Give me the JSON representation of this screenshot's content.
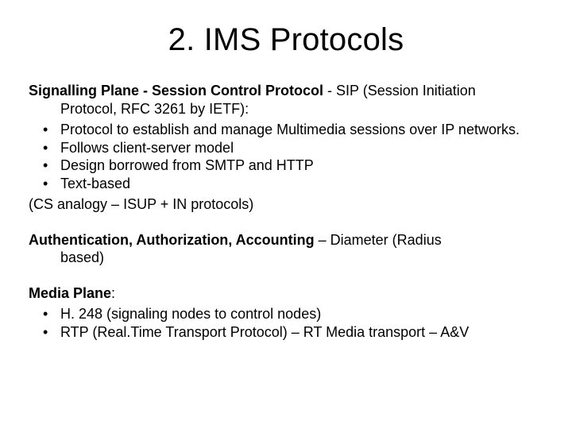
{
  "title": "2. IMS Protocols",
  "signalling": {
    "lead_bold": "Signalling Plane - Session Control Protocol",
    "lead_rest": " - SIP (Session Initiation",
    "lead_line2": "Protocol, RFC 3261 by IETF):",
    "bullets": [
      "Protocol to establish and manage Multimedia sessions over IP networks.",
      "Follows client-server model",
      "Design borrowed from SMTP and HTTP",
      "Text-based"
    ],
    "footer": "(CS analogy – ISUP + IN protocols)"
  },
  "aaa": {
    "lead_bold": "Authentication, Authorization, Accounting",
    "lead_rest": " – Diameter (Radius",
    "lead_line2": "based)"
  },
  "media": {
    "lead_bold": "Media Plane",
    "lead_rest": ":",
    "bullets": [
      "H. 248 (signaling nodes to control nodes)",
      "RTP (Real.Time Transport Protocol) – RT Media transport – A&V"
    ]
  }
}
